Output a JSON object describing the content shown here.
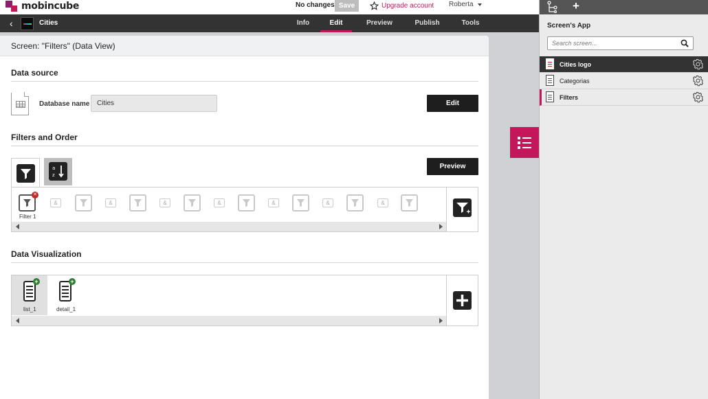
{
  "topbar": {
    "logo_text": "mobincube",
    "status": "No changes",
    "save_label": "Save",
    "upgrade_label": "Upgrade account",
    "user_name": "Roberta"
  },
  "navbar": {
    "app_title": "Cities",
    "tabs": [
      {
        "label": "Info"
      },
      {
        "label": "Edit"
      },
      {
        "label": "Preview"
      },
      {
        "label": "Publish"
      },
      {
        "label": "Tools"
      }
    ],
    "active_tab": "Edit"
  },
  "panel": {
    "header": "Screen: \"Filters\" (Data View)",
    "data_source": {
      "title": "Data source",
      "db_label": "Database name",
      "db_value": "Cities",
      "edit_label": "Edit"
    },
    "filters": {
      "title": "Filters and Order",
      "preview_label": "Preview",
      "first_filter_label": "Filter 1",
      "amp_symbol": "&"
    },
    "visualization": {
      "title": "Data Visualization",
      "items": [
        {
          "label": "list_1"
        },
        {
          "label": "detail_1"
        }
      ]
    }
  },
  "sidebar": {
    "title": "Screen's App",
    "search_placeholder": "Search screen...",
    "screens": [
      {
        "label": "Cities logo"
      },
      {
        "label": "Categorias"
      },
      {
        "label": "Filters"
      }
    ]
  },
  "colors": {
    "accent": "#c2185b",
    "dark_bar": "#333333",
    "badge_remove": "#c62828",
    "badge_add": "#2e7d32"
  }
}
